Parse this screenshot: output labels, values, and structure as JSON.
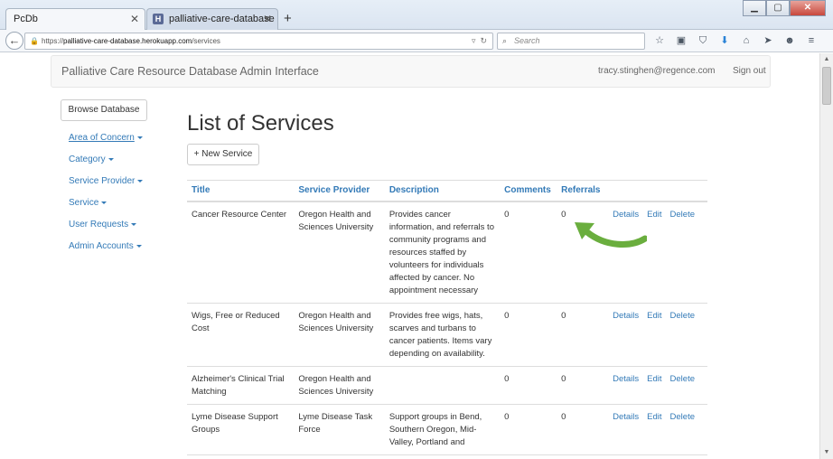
{
  "browser": {
    "tabs": [
      {
        "label": "PcDb",
        "active": true
      },
      {
        "label": "palliative-care-database - G...",
        "active": false
      }
    ],
    "url_scheme": "https://",
    "url_host": "palliative-care-database.herokuapp.com",
    "url_path": "/services",
    "search_placeholder": "Search"
  },
  "header": {
    "brand": "Palliative Care Resource Database Admin Interface",
    "user": "tracy.stinghen@regence.com",
    "signout": "Sign out"
  },
  "sidebar": {
    "browse_button": "Browse Database",
    "items": [
      {
        "label": "Area of Concern"
      },
      {
        "label": "Category"
      },
      {
        "label": "Service Provider"
      },
      {
        "label": "Service"
      },
      {
        "label": "User Requests"
      },
      {
        "label": "Admin Accounts"
      }
    ]
  },
  "main": {
    "title": "List of Services",
    "new_button": "+ New Service",
    "columns": [
      "Title",
      "Service Provider",
      "Description",
      "Comments",
      "Referrals"
    ],
    "actions": {
      "details": "Details",
      "edit": "Edit",
      "delete": "Delete"
    },
    "rows": [
      {
        "title": "Cancer Resource Center",
        "provider": "Oregon Health and Sciences University",
        "description": "Provides cancer information, and referrals to community programs and resources staffed by volunteers for individuals affected by cancer. No appointment necessary",
        "comments": "0",
        "referrals": "0"
      },
      {
        "title": "Wigs, Free or Reduced Cost",
        "provider": "Oregon Health and Sciences University",
        "description": "Provides free wigs, hats, scarves and turbans to cancer patients. Items vary depending on availability.",
        "comments": "0",
        "referrals": "0"
      },
      {
        "title": "Alzheimer's Clinical Trial Matching",
        "provider": "Oregon Health and Sciences University",
        "description": "",
        "comments": "0",
        "referrals": "0"
      },
      {
        "title": "Lyme Disease Support Groups",
        "provider": "Lyme Disease Task Force",
        "description": "Support groups in Bend, Southern Oregon, Mid-Valley, Portland and",
        "comments": "0",
        "referrals": "0"
      }
    ]
  },
  "colors": {
    "link": "#337ab7",
    "arrow": "#6aae3e"
  }
}
